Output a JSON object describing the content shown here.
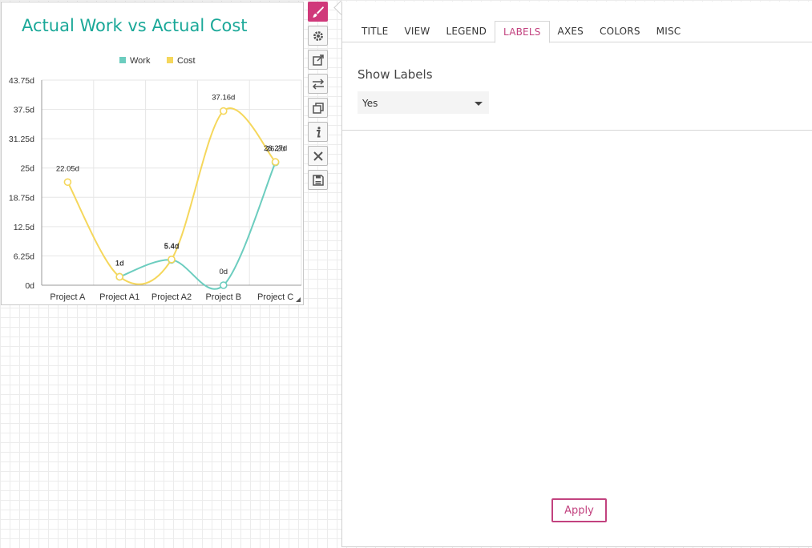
{
  "chart": {
    "title": "Actual Work vs Actual Cost"
  },
  "toolbar": [
    {
      "name": "brush-icon",
      "active": true
    },
    {
      "name": "gear-icon",
      "active": false
    },
    {
      "name": "external-link-icon",
      "active": false
    },
    {
      "name": "swap-arrows-icon",
      "active": false
    },
    {
      "name": "duplicate-icon",
      "active": false
    },
    {
      "name": "info-icon",
      "active": false
    },
    {
      "name": "close-icon",
      "active": false
    },
    {
      "name": "save-icon",
      "active": false
    }
  ],
  "panel": {
    "tabs": [
      "TITLE",
      "VIEW",
      "LEGEND",
      "LABELS",
      "AXES",
      "COLORS",
      "MISC"
    ],
    "active_tab": "LABELS",
    "show_labels_label": "Show Labels",
    "show_labels_value": "Yes",
    "apply_label": "Apply"
  },
  "chart_data": {
    "type": "line",
    "title": "Actual Work vs Actual Cost",
    "categories": [
      "Project A",
      "Project A1",
      "Project A2",
      "Project B",
      "Project C"
    ],
    "y_ticks": [
      "0d",
      "6.25d",
      "12.5d",
      "18.75d",
      "25d",
      "31.25d",
      "37.5d",
      "43.75d"
    ],
    "ylim": [
      0,
      43.75
    ],
    "grid": true,
    "legend_position": "top-center",
    "series": [
      {
        "name": "Work",
        "color": "#6ccdbf",
        "values": [
          null,
          1.8,
          5.4,
          0,
          26.2
        ],
        "labels": [
          "",
          "1d",
          "5.4d",
          "0d",
          "26.2d"
        ]
      },
      {
        "name": "Cost",
        "color": "#f5d75c",
        "values": [
          22,
          1.8,
          5.5,
          37.16,
          26.3
        ],
        "labels": [
          "22.05d",
          "1d",
          "5.4d",
          "37.16d",
          "26.27d"
        ]
      }
    ]
  }
}
